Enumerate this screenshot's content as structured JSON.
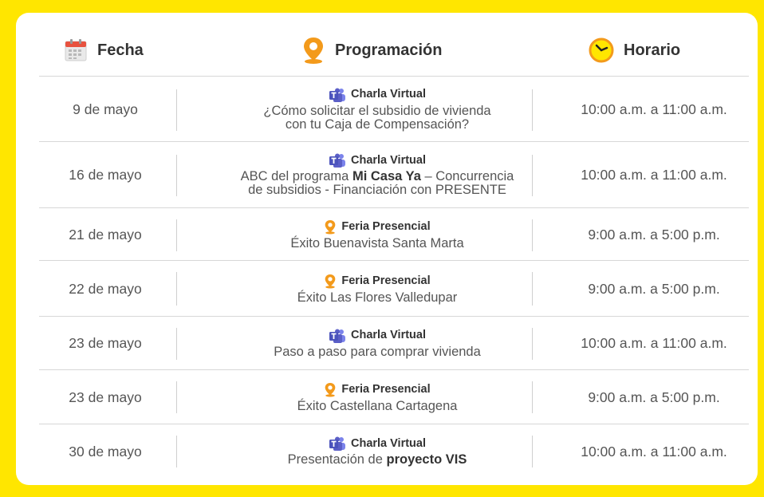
{
  "header": {
    "fecha": "Fecha",
    "programacion": "Programación",
    "horario": "Horario"
  },
  "icons": {
    "fecha": "calendar-icon",
    "programacion": "location-pin-icon",
    "horario": "clock-icon",
    "virtual": "teams-icon",
    "presencial": "location-pin-icon"
  },
  "colors": {
    "background": "#ffe600",
    "teams": "#5b5fc7",
    "pin": "#f39a1b",
    "text": "#555555"
  },
  "rows": [
    {
      "date": "9 de mayo",
      "kind": "Charla Virtual",
      "type": "virtual",
      "line1": "¿Cómo solicitar el subsidio de vivienda",
      "line2_pre": "con tu Caja de Compensación?",
      "line2_bold": "",
      "line2_post": "",
      "time": "10:00 a.m. a 11:00 a.m."
    },
    {
      "date": "16 de mayo",
      "kind": "Charla Virtual",
      "type": "virtual",
      "line1_pre": "ABC del programa ",
      "line1_bold": "Mi Casa Ya",
      "line1_post": " – Concurrencia",
      "line2_pre": "de subsidios - Financiación con PRESENTE",
      "line2_bold": "",
      "line2_post": "",
      "time": "10:00 a.m. a 11:00 a.m."
    },
    {
      "date": "21 de mayo",
      "kind": "Feria Presencial",
      "type": "presencial",
      "line1": "Éxito Buenavista Santa Marta",
      "time": "9:00 a.m. a 5:00 p.m."
    },
    {
      "date": "22 de mayo",
      "kind": "Feria Presencial",
      "type": "presencial",
      "line1": "Éxito Las Flores Valledupar",
      "time": "9:00 a.m. a 5:00 p.m."
    },
    {
      "date": "23 de mayo",
      "kind": "Charla Virtual",
      "type": "virtual",
      "line1": "Paso a paso para comprar vivienda",
      "time": "10:00 a.m. a 11:00 a.m."
    },
    {
      "date": "23 de mayo",
      "kind": "Feria Presencial",
      "type": "presencial",
      "line1": "Éxito Castellana Cartagena",
      "time": "9:00 a.m. a 5:00 p.m."
    },
    {
      "date": "30 de mayo",
      "kind": "Charla Virtual",
      "type": "virtual",
      "line1_pre": "Presentación de ",
      "line1_bold": "proyecto VIS",
      "line1_post": "",
      "time": "10:00 a.m. a 11:00 a.m."
    }
  ]
}
